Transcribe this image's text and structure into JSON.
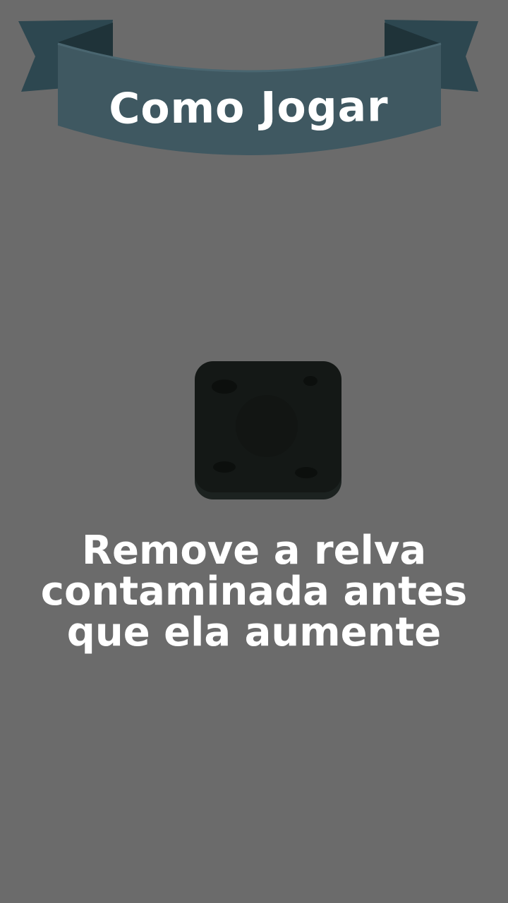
{
  "header": {
    "title": "Como Jogar"
  },
  "instruction": {
    "lines": [
      "Remove a relva",
      "contaminada antes",
      "que ela aumente"
    ]
  },
  "tile": {
    "icon": "contaminated-grass-tile-icon"
  },
  "colors": {
    "background": "#6b6b6b",
    "ribbon": "#3f5861",
    "ribbon_dark": "#2d4750",
    "ribbon_fold": "#1f3339",
    "tile": "#141816",
    "text": "#ffffff"
  }
}
